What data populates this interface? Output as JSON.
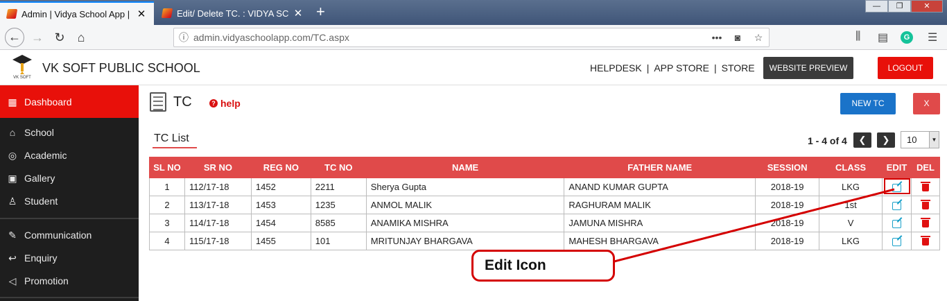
{
  "browser": {
    "tabs": [
      {
        "title": "Admin | Vidya School App | It's",
        "active": true
      },
      {
        "title": "Edit/ Delete TC. : VIDYA SCHOO",
        "active": false
      }
    ],
    "url": "admin.vidyaschoolapp.com/TC.aspx",
    "grammarly_letter": "G"
  },
  "header": {
    "school_name": "VK SOFT PUBLIC SCHOOL",
    "logo_text": "VK SOFT",
    "links": [
      "HELPDESK",
      "|",
      "APP STORE",
      "|",
      "STORE"
    ],
    "preview_button": "WEBSITE PREVIEW",
    "logout_button": "LOGOUT"
  },
  "sidebar": {
    "items": [
      {
        "label": "Dashboard",
        "icon": "dashboard-icon"
      },
      {
        "label": "School",
        "icon": "school-icon"
      },
      {
        "label": "Academic",
        "icon": "globe-icon"
      },
      {
        "label": "Gallery",
        "icon": "image-icon"
      },
      {
        "label": "Student",
        "icon": "student-icon"
      },
      {
        "label": "Communication",
        "icon": "megaphone-icon"
      },
      {
        "label": "Enquiry",
        "icon": "reply-icon"
      },
      {
        "label": "Promotion",
        "icon": "bullhorn-icon"
      }
    ]
  },
  "page": {
    "title": "TC",
    "help_label": "help",
    "new_button": "NEW TC",
    "close_button": "X"
  },
  "list": {
    "title": "TC List",
    "pager_text": "1 - 4 of 4",
    "page_size": "10"
  },
  "table": {
    "columns": [
      "SL NO",
      "SR NO",
      "REG NO",
      "TC NO",
      "NAME",
      "FATHER NAME",
      "SESSION",
      "CLASS",
      "EDIT",
      "DEL"
    ],
    "rows": [
      [
        "1",
        "112/17-18",
        "1452",
        "2211",
        "Sherya Gupta",
        "ANAND KUMAR GUPTA",
        "2018-19",
        "LKG"
      ],
      [
        "2",
        "113/17-18",
        "1453",
        "1235",
        "ANMOL MALIK",
        "RAGHURAM MALIK",
        "2018-19",
        "1st"
      ],
      [
        "3",
        "114/17-18",
        "1454",
        "8585",
        "ANAMIKA MISHRA",
        "JAMUNA MISHRA",
        "2018-19",
        "V"
      ],
      [
        "4",
        "115/17-18",
        "1455",
        "101",
        "MRITUNJAY BHARGAVA",
        "MAHESH BHARGAVA",
        "2018-19",
        "LKG"
      ]
    ]
  },
  "annotation": {
    "label": "Edit Icon",
    "color": "#d40000"
  }
}
